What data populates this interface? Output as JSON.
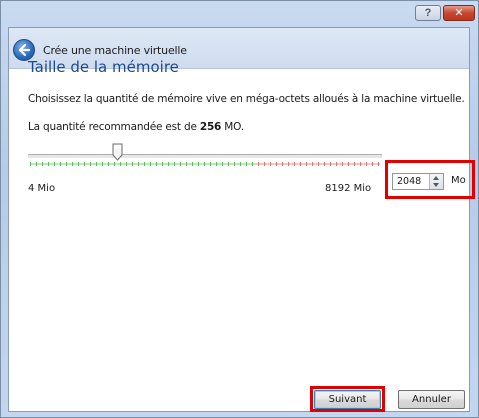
{
  "window": {
    "help_label": "?",
    "close_label": "✕"
  },
  "wizard": {
    "title": "Crée une machine virtuelle",
    "back_icon": "back-arrow-icon"
  },
  "page": {
    "title": "Taille de la mémoire",
    "description": "Choisissez la quantité de mémoire vive en méga-octets alloués à la machine virtuelle.",
    "recommended_prefix": "La quantité recommandée est de ",
    "recommended_value": "256",
    "recommended_suffix": " MO."
  },
  "memory": {
    "min_label": "4 Mio",
    "max_label": "8192 Mio",
    "value": "2048",
    "unit": "Mo",
    "slider_fraction": 0.25,
    "green_fraction": 0.65
  },
  "buttons": {
    "next_label": "Suivant",
    "cancel_label": "Annuler"
  },
  "colors": {
    "title_blue": "#1b4a93",
    "highlight_red": "#e00000",
    "tick_green": "#55c055",
    "tick_red": "#e07070"
  }
}
